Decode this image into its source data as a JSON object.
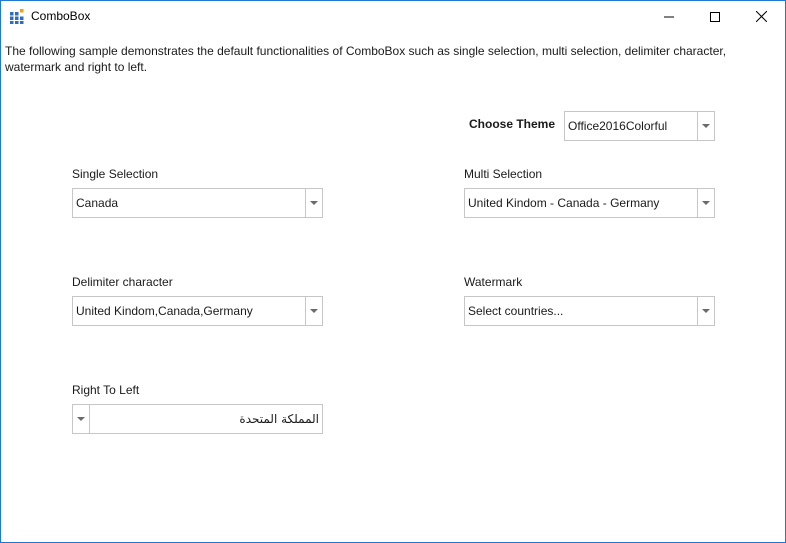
{
  "window": {
    "title": "ComboBox",
    "icons": {
      "app": "grid-app-icon",
      "minimize": "minimize-icon",
      "maximize": "maximize-icon",
      "close": "close-icon"
    }
  },
  "description": "The following sample demonstrates the default functionalities of ComboBox such as single selection, multi selection, delimiter character, watermark and right to left.",
  "theme": {
    "label": "Choose Theme",
    "value": "Office2016Colorful"
  },
  "single_selection": {
    "label": "Single Selection",
    "value": "Canada"
  },
  "multi_selection": {
    "label": "Multi Selection",
    "value": "United Kindom - Canada - Germany"
  },
  "delimiter": {
    "label": "Delimiter character",
    "value": "United Kindom,Canada,Germany"
  },
  "watermark": {
    "label": "Watermark",
    "value": "Select countries..."
  },
  "right_to_left": {
    "label": "Right To Left",
    "value": "المملكة المتحدة"
  },
  "colors": {
    "window_border": "#1e78d4",
    "combo_border": "#c6c6c6",
    "arrow": "#6a6a6a"
  }
}
